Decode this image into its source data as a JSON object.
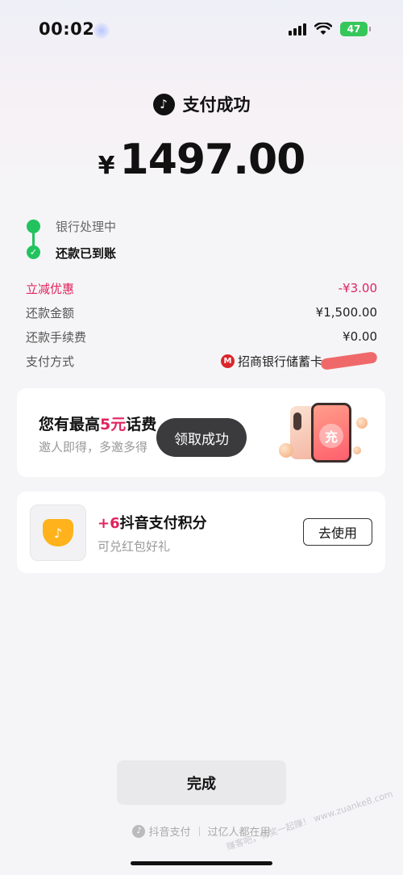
{
  "status_bar": {
    "time": "00:02",
    "battery": "47"
  },
  "header": {
    "title": "支付成功"
  },
  "amount": {
    "currency": "¥",
    "value": "1497.00"
  },
  "timeline": {
    "step1": "银行处理中",
    "step2": "还款已到账"
  },
  "details": [
    {
      "label": "立减优惠",
      "value": "-¥3.00"
    },
    {
      "label": "还款金额",
      "value": "¥1,500.00"
    },
    {
      "label": "还款手续费",
      "value": "¥0.00"
    },
    {
      "label": "支付方式",
      "value": "招商银行储蓄卡"
    }
  ],
  "promo": {
    "title_prefix": "您有最高",
    "title_highlight": "5元",
    "title_suffix": "话费",
    "subtitle": "邀人即得，多邀多得",
    "charge_icon": "充"
  },
  "toast": {
    "text": "领取成功"
  },
  "points": {
    "count": "+6",
    "title": "抖音支付积分",
    "subtitle": "可兑红包好礼",
    "button": "去使用"
  },
  "done_button": "完成",
  "footer": {
    "brand": "抖音支付",
    "slogan": "过亿人都在用"
  },
  "watermark": "赚客吧，有奖一起赚！ www.zuanke8.com",
  "colors": {
    "accent_red": "#e0245e",
    "success_green": "#22c35e",
    "toast_bg": "#3b3b3e"
  }
}
